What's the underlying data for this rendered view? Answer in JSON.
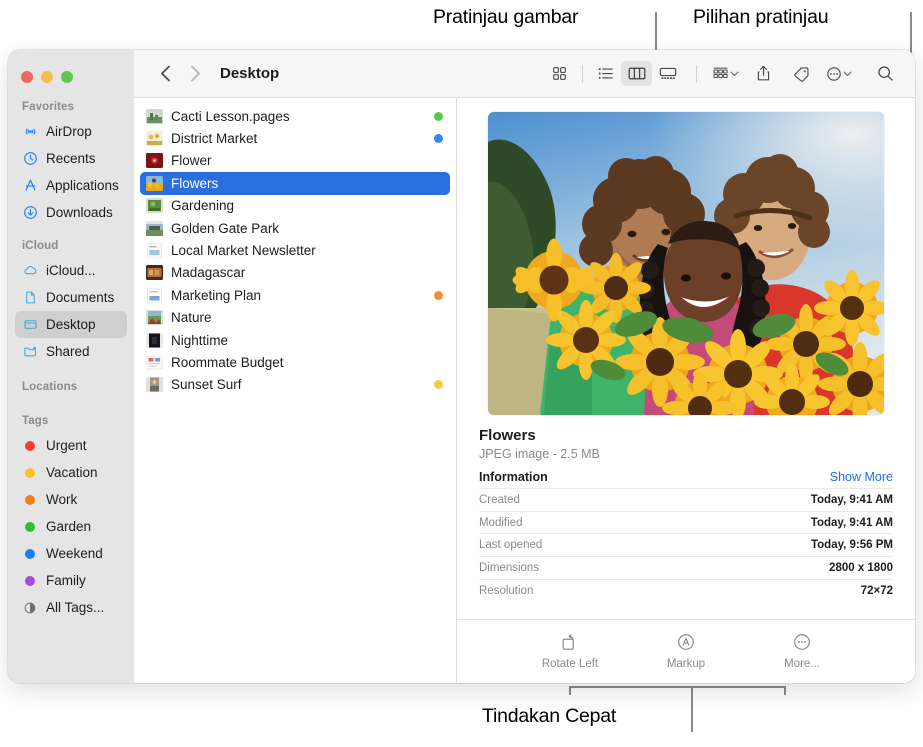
{
  "annotations": {
    "top_left": "Pratinjau gambar",
    "top_right": "Pilihan pratinjau",
    "bottom": "Tindakan Cepat"
  },
  "window": {
    "traffic_lights": [
      "close-button",
      "minimize-button",
      "maximize-button"
    ]
  },
  "toolbar": {
    "back_icon": "chevron-left-icon",
    "forward_icon": "chevron-right-icon",
    "breadcrumb": "Desktop",
    "view_icon": "icon-view-icon",
    "list_icon": "list-view-icon",
    "column_icon": "column-view-icon",
    "gallery_icon": "gallery-view-icon",
    "group_icon": "group-by-icon",
    "share_icon": "share-icon",
    "tag_icon": "tag-icon",
    "more_icon": "more-circle-icon",
    "search_icon": "search-icon"
  },
  "sidebar": {
    "sections": [
      {
        "title": "Favorites",
        "items": [
          {
            "label": "AirDrop",
            "icon": "airdrop-icon",
            "selected": false
          },
          {
            "label": "Recents",
            "icon": "clock-icon",
            "selected": false
          },
          {
            "label": "Applications",
            "icon": "applications-icon",
            "selected": false
          },
          {
            "label": "Downloads",
            "icon": "downloads-icon",
            "selected": false
          }
        ]
      },
      {
        "title": "iCloud",
        "items": [
          {
            "label": "iCloud...",
            "icon": "cloud-icon",
            "selected": false
          },
          {
            "label": "Documents",
            "icon": "document-icon",
            "selected": false
          },
          {
            "label": "Desktop",
            "icon": "desktop-icon",
            "selected": true
          },
          {
            "label": "Shared",
            "icon": "shared-folder-icon",
            "selected": false
          }
        ]
      },
      {
        "title": "Locations",
        "items": []
      },
      {
        "title": "Tags",
        "items": [
          {
            "label": "Urgent",
            "icon": "tag-dot-icon",
            "color": "#fc3b2f",
            "selected": false
          },
          {
            "label": "Vacation",
            "icon": "tag-dot-icon",
            "color": "#fcc02c",
            "selected": false
          },
          {
            "label": "Work",
            "icon": "tag-dot-icon",
            "color": "#f08019",
            "selected": false
          },
          {
            "label": "Garden",
            "icon": "tag-dot-icon",
            "color": "#28c231",
            "selected": false
          },
          {
            "label": "Weekend",
            "icon": "tag-dot-icon",
            "color": "#1d7ef6",
            "selected": false
          },
          {
            "label": "Family",
            "icon": "tag-dot-icon",
            "color": "#a24fdb",
            "selected": false
          },
          {
            "label": "All Tags...",
            "icon": "all-tags-icon",
            "color": "",
            "selected": false
          }
        ]
      }
    ]
  },
  "files": [
    {
      "name": "Cacti Lesson.pages",
      "tag": "#5bc94f",
      "selected": false,
      "thumb": "c1"
    },
    {
      "name": "District Market",
      "tag": "#3b85f0",
      "selected": false,
      "thumb": "c2"
    },
    {
      "name": "Flower",
      "tag": "",
      "selected": false,
      "thumb": "c3"
    },
    {
      "name": "Flowers",
      "tag": "",
      "selected": true,
      "thumb": "c4"
    },
    {
      "name": "Gardening",
      "tag": "",
      "selected": false,
      "thumb": "c5"
    },
    {
      "name": "Golden Gate Park",
      "tag": "",
      "selected": false,
      "thumb": "c6"
    },
    {
      "name": "Local Market Newsletter",
      "tag": "",
      "selected": false,
      "thumb": "c7"
    },
    {
      "name": "Madagascar",
      "tag": "",
      "selected": false,
      "thumb": "c8"
    },
    {
      "name": "Marketing Plan",
      "tag": "#f0912d",
      "selected": false,
      "thumb": "c9"
    },
    {
      "name": "Nature",
      "tag": "",
      "selected": false,
      "thumb": "c10"
    },
    {
      "name": "Nighttime",
      "tag": "",
      "selected": false,
      "thumb": "c11"
    },
    {
      "name": "Roommate Budget",
      "tag": "",
      "selected": false,
      "thumb": "c12"
    },
    {
      "name": "Sunset Surf",
      "tag": "#f5cf3e",
      "selected": false,
      "thumb": "c13"
    }
  ],
  "preview": {
    "title": "Flowers",
    "subtitle": "JPEG image - 2.5 MB",
    "section_title": "Information",
    "show_more": "Show More",
    "image_alt": "three-people-holding-sunflowers-photo",
    "info": [
      {
        "key": "Created",
        "value": "Today, 9:41 AM"
      },
      {
        "key": "Modified",
        "value": "Today, 9:41 AM"
      },
      {
        "key": "Last opened",
        "value": "Today, 9:56 PM"
      },
      {
        "key": "Dimensions",
        "value": "2800 x 1800"
      },
      {
        "key": "Resolution",
        "value": "72×72"
      }
    ],
    "actions": [
      {
        "label": "Rotate Left",
        "icon": "rotate-left-icon"
      },
      {
        "label": "Markup",
        "icon": "markup-icon"
      },
      {
        "label": "More...",
        "icon": "more-circle-icon"
      }
    ]
  }
}
